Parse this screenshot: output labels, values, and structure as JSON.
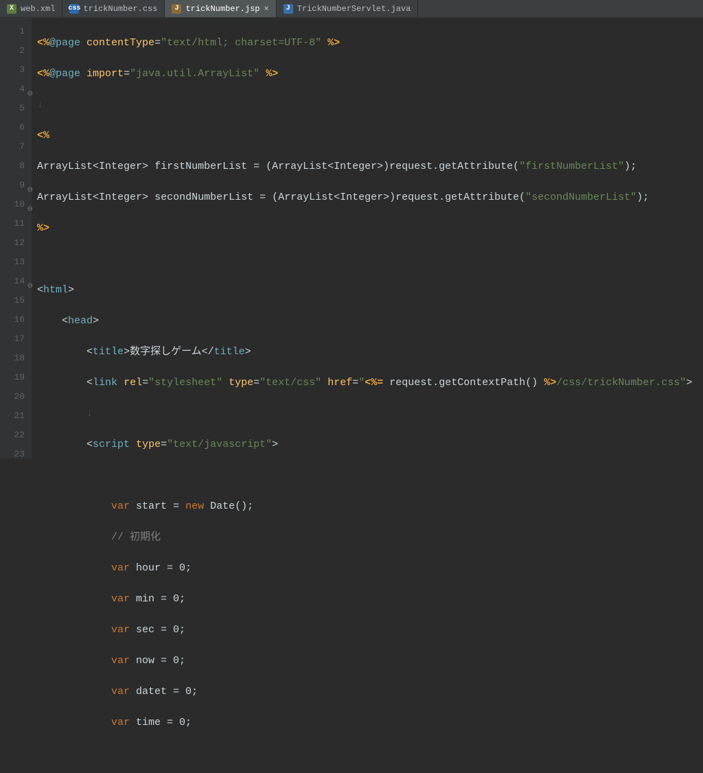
{
  "tabs": [
    {
      "label": "web.xml",
      "icon": "X"
    },
    {
      "label": "trickNumber.css",
      "icon": "css"
    },
    {
      "label": "trickNumber.jsp",
      "icon": "J",
      "active": true
    },
    {
      "label": "TrickNumberServlet.java",
      "icon": "J"
    }
  ],
  "closeGlyph": "×",
  "lineNumbers": [
    "1",
    "2",
    "3",
    "4",
    "5",
    "6",
    "7",
    "8",
    "9",
    "10",
    "11",
    "12",
    "13",
    "14",
    "15",
    "16",
    "17",
    "18",
    "19",
    "20",
    "21",
    "22",
    "23"
  ],
  "foldable": {
    "4": true,
    "9": true,
    "10": true,
    "14": true
  },
  "tokens": {
    "pageDir": "@page",
    "contentTypeAttr": "contentType",
    "contentTypeVal": "\"text/html; charset=UTF-8\"",
    "importAttr": "import",
    "importVal": "\"java.util.ArrayList\"",
    "arrlist": "ArrayList",
    "integer": "Integer",
    "lt": "<",
    "gt": ">",
    "firstVar": " firstNumberList = (",
    "secondVar": " secondNumberList = (",
    "castClose": ")request.getAttribute(",
    "firstStr": "\"firstNumberList\"",
    "secondStr": "\"secondNumberList\"",
    "semClose": ");",
    "htmlOpen": "html",
    "headOpen": "head",
    "titleOpen": "title",
    "titleText": "数字探しゲーム",
    "titleClose": "title",
    "linkTag": "link",
    "relAttr": "rel",
    "relVal": "\"stylesheet\"",
    "typeAttr": "type",
    "typeCssVal": "\"text/css\"",
    "hrefAttr": "href",
    "hrefQuote": "\"",
    "ctxPath": " request.getContextPath() ",
    "cssPath": "/css/trickNumber.css\"",
    "scriptTag": "script",
    "typeJsVal": "\"text/javascript\"",
    "varKw": "var",
    "newKw": "new",
    "startLine": " start = ",
    "dateCall": " Date();",
    "comment": "// 初期化",
    "hourLine": " hour = 0;",
    "minLine": " min = 0;",
    "secLine": " sec = 0;",
    "nowLine": " now = 0;",
    "datetLine": " datet = 0;",
    "timeLine": " time = 0;",
    "scriptletOpen": "<%",
    "scriptletClose": "%>",
    "eq": "=",
    "sp": " "
  }
}
